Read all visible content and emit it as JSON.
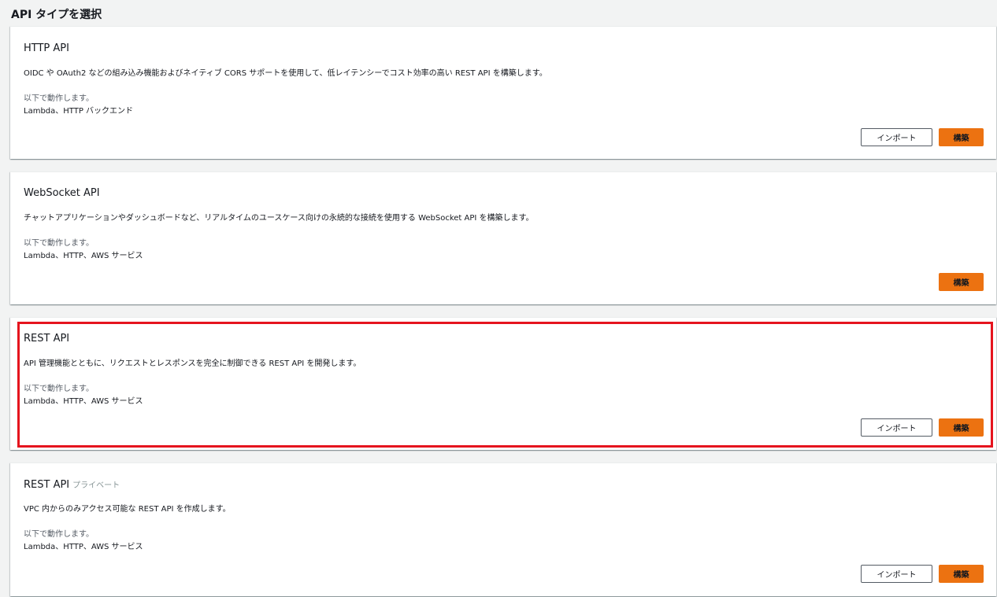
{
  "page": {
    "title": "API タイプを選択"
  },
  "works_with_label": "以下で動作します。",
  "buttons": {
    "import": "インポート",
    "build": "構築"
  },
  "cards": [
    {
      "title": "HTTP API",
      "badge": "",
      "description": "OIDC や OAuth2 などの組み込み機能およびネイティブ CORS サポートを使用して、低レイテンシーでコスト効率の高い REST API を構築します。",
      "works_with": "Lambda、HTTP バックエンド",
      "has_import": true
    },
    {
      "title": "WebSocket API",
      "badge": "",
      "description": "チャットアプリケーションやダッシュボードなど、リアルタイムのユースケース向けの永続的な接続を使用する WebSocket API を構築します。",
      "works_with": "Lambda、HTTP、AWS サービス",
      "has_import": false
    },
    {
      "title": "REST API",
      "badge": "",
      "description": "API 管理機能とともに、リクエストとレスポンスを完全に制御できる REST API を開発します。",
      "works_with": "Lambda、HTTP、AWS サービス",
      "has_import": true,
      "highlighted": true
    },
    {
      "title": "REST API",
      "badge": "プライベート",
      "description": "VPC 内からのみアクセス可能な REST API を作成します。",
      "works_with": "Lambda、HTTP、AWS サービス",
      "has_import": true
    }
  ],
  "colors": {
    "build_button": "#ec7211",
    "highlight_border": "#e5141e"
  }
}
